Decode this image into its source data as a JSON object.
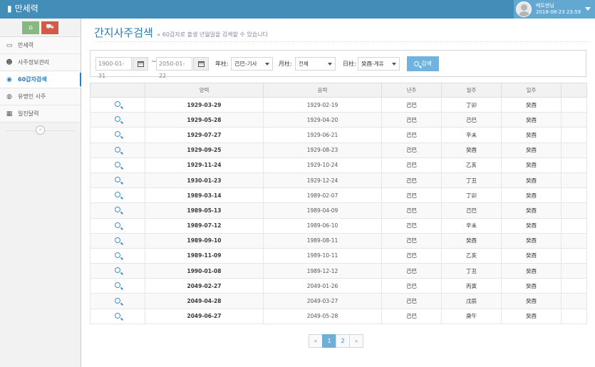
{
  "app": {
    "title": "만세력"
  },
  "user": {
    "name": "베트맨님",
    "datetime": "2018-08-23 23:59"
  },
  "sidebar": {
    "shortcuts": [
      {
        "icon": "home-icon",
        "glyph": "⌂"
      },
      {
        "icon": "cart-icon",
        "glyph": "⛟"
      }
    ],
    "items": [
      {
        "label": "만세력",
        "icon": "desktop-icon",
        "glyph": "▭"
      },
      {
        "label": "사주정보관리",
        "icon": "users-icon",
        "glyph": "☻"
      },
      {
        "label": "60갑자검색",
        "icon": "eye-icon",
        "glyph": "◉"
      },
      {
        "label": "유명인 사주",
        "icon": "globe-icon",
        "glyph": "◍"
      },
      {
        "label": "일진달력",
        "icon": "calendar-icon",
        "glyph": "▦"
      }
    ],
    "collapse_glyph": "«"
  },
  "page": {
    "title": "간지사주검색",
    "subtitle": "» 60갑자로 출생 년월일을 검색할 수 있습니다"
  },
  "filters": {
    "date_from": "1900-01-31",
    "date_to": "2050-01-22",
    "dash": "~",
    "year_label": "年柱:",
    "year_value": "己巳-기사",
    "month_label": "月柱:",
    "month_value": "전체",
    "day_label": "日柱:",
    "day_value": "癸酉-계유",
    "search_label": "검색"
  },
  "table": {
    "headers": [
      "",
      "양력",
      "음력",
      "년주",
      "월주",
      "일주",
      ""
    ],
    "rows": [
      {
        "solar": "1929-03-29",
        "lunar": "1929-02-19",
        "year": "己巳",
        "month": "丁卯",
        "day": "癸酉"
      },
      {
        "solar": "1929-05-28",
        "lunar": "1929-04-20",
        "year": "己巳",
        "month": "己巳",
        "day": "癸酉"
      },
      {
        "solar": "1929-07-27",
        "lunar": "1929-06-21",
        "year": "己巳",
        "month": "辛未",
        "day": "癸酉"
      },
      {
        "solar": "1929-09-25",
        "lunar": "1929-08-23",
        "year": "己巳",
        "month": "癸酉",
        "day": "癸酉"
      },
      {
        "solar": "1929-11-24",
        "lunar": "1929-10-24",
        "year": "己巳",
        "month": "乙亥",
        "day": "癸酉"
      },
      {
        "solar": "1930-01-23",
        "lunar": "1929-12-24",
        "year": "己巳",
        "month": "丁丑",
        "day": "癸酉"
      },
      {
        "solar": "1989-03-14",
        "lunar": "1989-02-07",
        "year": "己巳",
        "month": "丁卯",
        "day": "癸酉"
      },
      {
        "solar": "1989-05-13",
        "lunar": "1989-04-09",
        "year": "己巳",
        "month": "己巳",
        "day": "癸酉"
      },
      {
        "solar": "1989-07-12",
        "lunar": "1989-06-10",
        "year": "己巳",
        "month": "辛未",
        "day": "癸酉"
      },
      {
        "solar": "1989-09-10",
        "lunar": "1989-08-11",
        "year": "己巳",
        "month": "癸酉",
        "day": "癸酉"
      },
      {
        "solar": "1989-11-09",
        "lunar": "1989-10-11",
        "year": "己巳",
        "month": "乙亥",
        "day": "癸酉"
      },
      {
        "solar": "1990-01-08",
        "lunar": "1989-12-12",
        "year": "己巳",
        "month": "丁丑",
        "day": "癸酉"
      },
      {
        "solar": "2049-02-27",
        "lunar": "2049-01-26",
        "year": "己巳",
        "month": "丙寅",
        "day": "癸酉"
      },
      {
        "solar": "2049-04-28",
        "lunar": "2049-03-27",
        "year": "己巳",
        "month": "戊辰",
        "day": "癸酉"
      },
      {
        "solar": "2049-06-27",
        "lunar": "2049-05-28",
        "year": "己巳",
        "month": "庚午",
        "day": "癸酉"
      }
    ]
  },
  "pagination": {
    "prev": "«",
    "pages": [
      "1",
      "2"
    ],
    "next": "»",
    "active": "1"
  },
  "colors": {
    "navbar": "#438eb9",
    "accent": "#2b7dbc",
    "button": "#6fb3e0"
  }
}
